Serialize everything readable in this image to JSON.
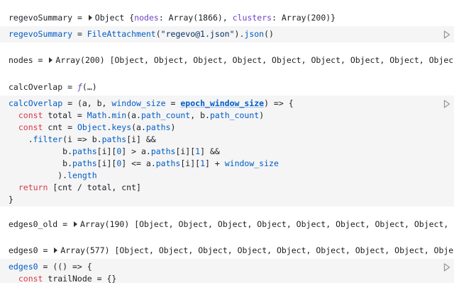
{
  "cells": {
    "c1": {
      "name": "regevoSummary",
      "eq": " = ",
      "type": "Object",
      "open": " {",
      "k1": "nodes",
      "v1": ": Array(1866), ",
      "k2": "clusters",
      "v2": ": Array(200)",
      "close": "}"
    },
    "c2": {
      "name": "regevoSummary",
      "eq": " = ",
      "fn": "FileAttachment",
      "p1": "(",
      "arg": "\"regevo@1.json\"",
      "p2": ").",
      "method": "json",
      "p3": "()"
    },
    "c3": {
      "name": "nodes",
      "eq": " = ",
      "type": "Array(200)",
      "rest": " [Object, Object, Object, Object, Object, Object, Object, Object, Object, Obj"
    },
    "c4": {
      "name": "calcOverlap",
      "eq": " = ",
      "f": "ƒ",
      "rest": "(…)"
    },
    "c5": {
      "l1": {
        "name": "calcOverlap",
        "a": " = (a, b, ",
        "ws": "window_size",
        "b": " = ",
        "ref": "epoch_window_size",
        "c": ") => {"
      },
      "l2": {
        "kw": "  const",
        "a": " total = ",
        "obj": "Math",
        "b": ".",
        "m": "min",
        "c": "(a.",
        "p1": "path_count",
        "d": ", b.",
        "p2": "path_count",
        "e": ")"
      },
      "l3": {
        "kw": "  const",
        "a": " cnt = ",
        "obj": "Object",
        "b": ".",
        "m": "keys",
        "c": "(a.",
        "p": "paths",
        "d": ")"
      },
      "l4": {
        "a": "    .",
        "m": "filter",
        "b": "(i => b.",
        "p": "paths",
        "c": "[i] &&"
      },
      "l5": {
        "a": "           b.",
        "p1": "paths",
        "b": "[i][",
        "n1": "0",
        "c": "] > a.",
        "p2": "paths",
        "d": "[i][",
        "n2": "1",
        "e": "] &&"
      },
      "l6": {
        "a": "           b.",
        "p1": "paths",
        "b": "[i][",
        "n1": "0",
        "c": "] <= a.",
        "p2": "paths",
        "d": "[i][",
        "n2": "1",
        "e": "] + ",
        "ws": "window_size"
      },
      "l7": {
        "a": "          ).",
        "p": "length"
      },
      "l8": {
        "kw": "  return",
        "a": " [cnt / total, cnt]"
      },
      "l9": {
        "a": "}"
      }
    },
    "c6": {
      "name": "edges0_old",
      "eq": " = ",
      "type": "Array(190)",
      "rest": " [Object, Object, Object, Object, Object, Object, Object, Object, Object"
    },
    "c7": {
      "name": "edges0",
      "eq": " = ",
      "type": "Array(577)",
      "rest": " [Object, Object, Object, Object, Object, Object, Object, Object, Object, Ob"
    },
    "c8": {
      "l1": {
        "name": "edges0",
        "a": " = (() => {"
      },
      "l2": {
        "kw": "  const",
        "a": " trailNode = {}"
      }
    }
  },
  "icons": {
    "run": "play-icon",
    "expand": "caret-right-icon"
  },
  "colors": {
    "keyword": "#d73a49",
    "identifier": "#005cc5",
    "object_key": "#6f42c1",
    "code_bg": "#f5f5f5"
  }
}
